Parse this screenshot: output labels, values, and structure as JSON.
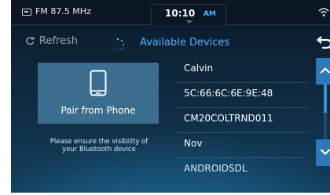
{
  "status_bar": {
    "source_icon": "radio-source-icon",
    "radio_station": "FM 87.5 MHz",
    "clock_time": "10:10",
    "clock_ampm": "AM",
    "signal_icon": "wifi-icon"
  },
  "header": {
    "refresh_label": "Refresh",
    "refresh_icon": "refresh-icon",
    "spinner_icon": "loading-spinner-icon",
    "title": "Available Devices",
    "back_icon": "back-arrow-icon"
  },
  "pair_button": {
    "label": "Pair from Phone",
    "icon": "phone-icon"
  },
  "visibility_note": "Please ensure the visibility of your Bluetooth device",
  "devices": [
    {
      "name": "Calvin"
    },
    {
      "name": "5C:66:6C:6E:9E:48"
    },
    {
      "name": "CM20COLTRND011"
    },
    {
      "name": "Nov"
    },
    {
      "name": "ANDROIDSDL"
    }
  ],
  "scroll": {
    "up_icon": "chevron-up-icon",
    "down_icon": "chevron-down-icon"
  },
  "colors": {
    "accent": "#4fb3ff",
    "button_bg": "#3a6d8e",
    "scroll_button": "#2c78b8",
    "background_top": "#0b1826",
    "background_bottom": "#12405e"
  }
}
